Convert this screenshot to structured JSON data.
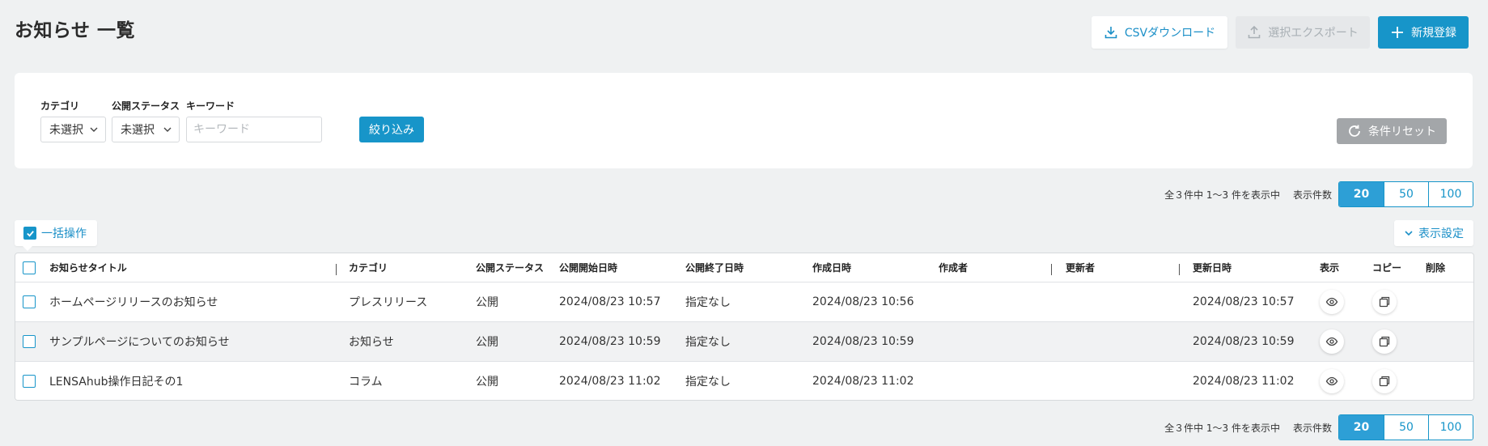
{
  "page": {
    "title": "お知らせ 一覧"
  },
  "toolbar": {
    "csv_download": "CSVダウンロード",
    "selected_export": "選択エクスポート",
    "new_register": "新規登録"
  },
  "filter": {
    "category_label": "カテゴリ",
    "category_value": "未選択",
    "status_label": "公開ステータス",
    "status_value": "未選択",
    "keyword_label": "キーワード",
    "keyword_placeholder": "キーワード",
    "keyword_value": "",
    "apply_button": "絞り込み",
    "reset_button": "条件リセット"
  },
  "pagination": {
    "summary": "全３件中 1〜3 件を表示中",
    "per_page_label": "表示件数",
    "options": [
      "20",
      "50",
      "100"
    ],
    "selected": "20"
  },
  "bulk": {
    "label": "一括操作",
    "display_settings": "表示設定"
  },
  "table": {
    "headers": {
      "title": "お知らせタイトル",
      "category": "カテゴリ",
      "status": "公開ステータス",
      "start": "公開開始日時",
      "end": "公開終了日時",
      "created": "作成日時",
      "creator": "作成者",
      "updater": "更新者",
      "updated": "更新日時",
      "view": "表示",
      "copy": "コピー",
      "delete": "削除"
    },
    "rows": [
      {
        "title": "ホームページリリースのお知らせ",
        "category": "プレスリリース",
        "status": "公開",
        "start": "2024/08/23 10:57",
        "end": "指定なし",
        "created": "2024/08/23 10:56",
        "creator": "",
        "updater": "",
        "updated": "2024/08/23 10:57"
      },
      {
        "title": "サンプルページについてのお知らせ",
        "category": "お知らせ",
        "status": "公開",
        "start": "2024/08/23 10:59",
        "end": "指定なし",
        "created": "2024/08/23 10:59",
        "creator": "",
        "updater": "",
        "updated": "2024/08/23 10:59"
      },
      {
        "title": "LENSAhub操作日記その1",
        "category": "コラム",
        "status": "公開",
        "start": "2024/08/23 11:02",
        "end": "指定なし",
        "created": "2024/08/23 11:02",
        "creator": "",
        "updater": "",
        "updated": "2024/08/23 11:02"
      }
    ]
  },
  "icons": {
    "download": "download-icon",
    "upload": "upload-icon",
    "plus": "plus-icon",
    "chevron_down": "chevron-down-icon",
    "reset": "refresh-icon",
    "check": "check-icon",
    "eye": "eye-icon",
    "copy": "copy-icon"
  },
  "colors": {
    "primary": "#1795c9",
    "background": "#eff1f2",
    "disabled": "#a3a6a9"
  }
}
